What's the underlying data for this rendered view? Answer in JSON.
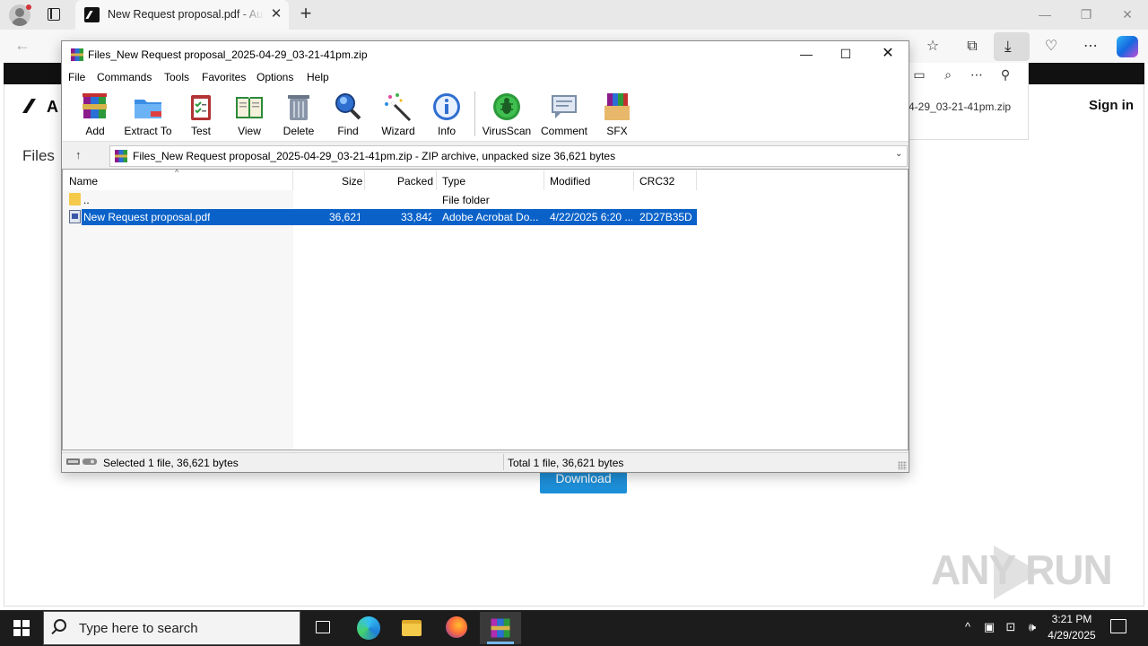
{
  "browser": {
    "tab_title": "New Request proposal.pdf - Auto",
    "tab_close": "✕",
    "new_tab": "+"
  },
  "page": {
    "logo_letter": "A",
    "files_label": "Files",
    "sign_in": "Sign in",
    "filename_snippet": "4-29_03-21-41pm.zip",
    "download_button": "Download",
    "watermark": "ANY RUN"
  },
  "winrar": {
    "title": "Files_New Request proposal_2025-04-29_03-21-41pm.zip",
    "menu": [
      "File",
      "Commands",
      "Tools",
      "Favorites",
      "Options",
      "Help"
    ],
    "toolbar": [
      "Add",
      "Extract To",
      "Test",
      "View",
      "Delete",
      "Find",
      "Wizard",
      "Info",
      "VirusScan",
      "Comment",
      "SFX"
    ],
    "path": "Files_New Request proposal_2025-04-29_03-21-41pm.zip - ZIP archive, unpacked size 36,621 bytes",
    "columns": [
      "Name",
      "Size",
      "Packed",
      "Type",
      "Modified",
      "CRC32"
    ],
    "rows": [
      {
        "name": "..",
        "size": "",
        "packed": "",
        "type": "File folder",
        "modified": "",
        "crc": ""
      },
      {
        "name": "New Request proposal.pdf",
        "size": "36,621",
        "packed": "33,842",
        "type": "Adobe Acrobat Do...",
        "modified": "4/22/2025 6:20 ...",
        "crc": "2D27B35D"
      }
    ],
    "status_left": "Selected 1 file, 36,621 bytes",
    "status_right": "Total 1 file, 36,621 bytes"
  },
  "taskbar": {
    "search_placeholder": "Type here to search",
    "time": "3:21 PM",
    "date": "4/29/2025"
  },
  "colors": {
    "selection": "#0a62c9",
    "download_button": "#1d8fd8",
    "taskbar": "#1c1c1c"
  }
}
